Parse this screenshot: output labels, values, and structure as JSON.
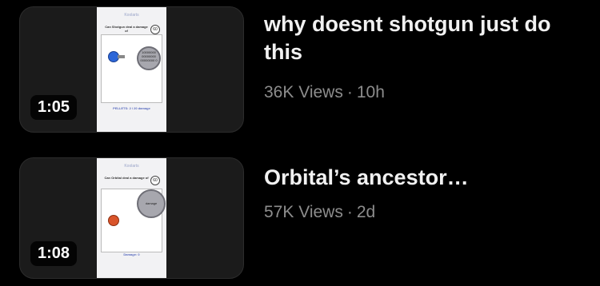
{
  "videos": [
    {
      "title": "why doesnt shotgun just do this",
      "views": "36K Views",
      "separator": "·",
      "age": "10h",
      "duration": "1:05",
      "thumbnail": {
        "brand": "Koolarts",
        "caption": "Can Shotgun deal a damage of",
        "score": "60",
        "boss_value": "10000000 00000000 00000000 0",
        "footer": "PELLETS: 2 / 20 damage"
      }
    },
    {
      "title": "Orbital’s ancestor…",
      "views": "57K Views",
      "separator": "·",
      "age": "2d",
      "duration": "1:08",
      "thumbnail": {
        "brand": "Koolarts",
        "caption": "Can Orbital deal a damage of",
        "score": "60",
        "boss_value": "damage",
        "footer": "Damage: 0"
      }
    }
  ]
}
